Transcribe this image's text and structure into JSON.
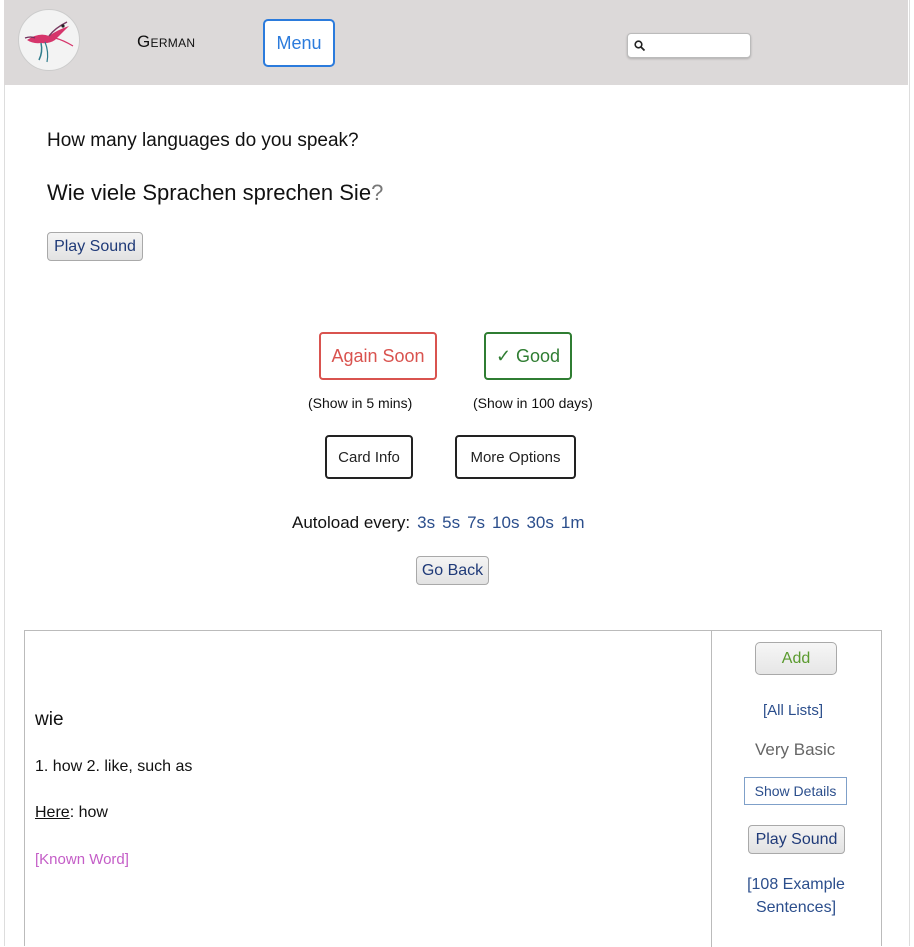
{
  "header": {
    "logo": "hummingbird-logo",
    "language": "German",
    "menu_label": "Menu",
    "search": {
      "value": "",
      "placeholder": "",
      "icon": "search-icon"
    }
  },
  "card": {
    "question_en": "How many languages do you speak?",
    "question_de": "Wie viele Sprachen sprechen Sie",
    "question_de_mark": "?",
    "play_sound_label": "Play Sound"
  },
  "review": {
    "again_label": "Again Soon",
    "again_hint": "(Show in 5 mins)",
    "good_label": "✓ Good",
    "good_hint": "(Show in 100 days)",
    "card_info_label": "Card Info",
    "more_options_label": "More Options",
    "autoload_label": "Autoload every:",
    "autoload_options": [
      "3s",
      "5s",
      "7s",
      "10s",
      "30s",
      "1m"
    ],
    "go_back_label": "Go Back"
  },
  "word_panel": {
    "word": "wie",
    "definitions": "1. how 2. like, such as",
    "here_label": "Here",
    "here_value": ": how",
    "known_label": "[Known Word]",
    "add_label": "Add",
    "all_lists_label": "[All Lists]",
    "level": "Very Basic",
    "show_details_label": "Show Details",
    "play_sound_label": "Play Sound",
    "examples_label": "[108 Example Sentences]"
  },
  "colors": {
    "header_bg": "#dcd9d9",
    "menu_blue": "#2b7bdc",
    "again_red": "#d9534f",
    "good_green": "#2f7d32",
    "link_blue": "#2b4e8c",
    "known_purple": "#c45dc7",
    "add_green": "#5a9a2e"
  }
}
